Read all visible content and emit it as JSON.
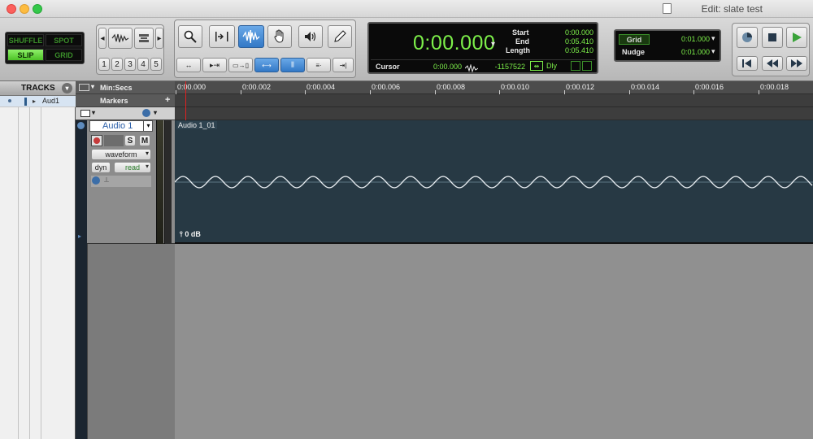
{
  "window": {
    "title": "Edit: slate test"
  },
  "edit_modes": {
    "shuffle": "SHUFFLE",
    "spot": "SPOT",
    "slip": "SLIP",
    "grid": "GRID"
  },
  "zoom_presets": [
    "1",
    "2",
    "3",
    "4",
    "5"
  ],
  "counter": {
    "main": "0:00.000",
    "start_label": "Start",
    "start_value": "0:00.000",
    "end_label": "End",
    "end_value": "0:05.410",
    "length_label": "Length",
    "length_value": "0:05.410",
    "cursor_label": "Cursor",
    "cursor_value": "0:00.000",
    "sample_value": "-1157522",
    "dly_label": "Dly"
  },
  "grid_nudge": {
    "grid_label": "Grid",
    "grid_value": "0:01.000",
    "nudge_label": "Nudge",
    "nudge_value": "0:01.000"
  },
  "tracks_panel": {
    "header": "TRACKS",
    "rows": [
      {
        "name": "Aud1"
      }
    ]
  },
  "rulers": {
    "timebase_label": "Min:Secs",
    "markers_label": "Markers",
    "ticks": [
      "0:00.000",
      "0:00.002",
      "0:00.004",
      "0:00.006",
      "0:00.008",
      "0:00.010",
      "0:00.012",
      "0:00.014",
      "0:00.016",
      "0:00.018"
    ]
  },
  "track": {
    "name": "Audio 1",
    "solo": "S",
    "mute": "M",
    "view": "waveform",
    "automation_view": "dyn",
    "automation_mode": "read"
  },
  "clip": {
    "name": "Audio 1_01",
    "gain": "0 dB"
  },
  "colors": {
    "counter_green": "#7df04a",
    "selected_blue": "#3278c6",
    "clip_bg": "#273944",
    "playhead": "#e02020"
  },
  "icons": [
    "zoom-icon",
    "trim-icon",
    "selector-icon",
    "grabber-icon",
    "scrub-icon",
    "pencil-icon",
    "rewind-icon",
    "stop-icon",
    "play-icon",
    "return-to-zero-icon",
    "fast-forward-icon",
    "online-icon"
  ]
}
